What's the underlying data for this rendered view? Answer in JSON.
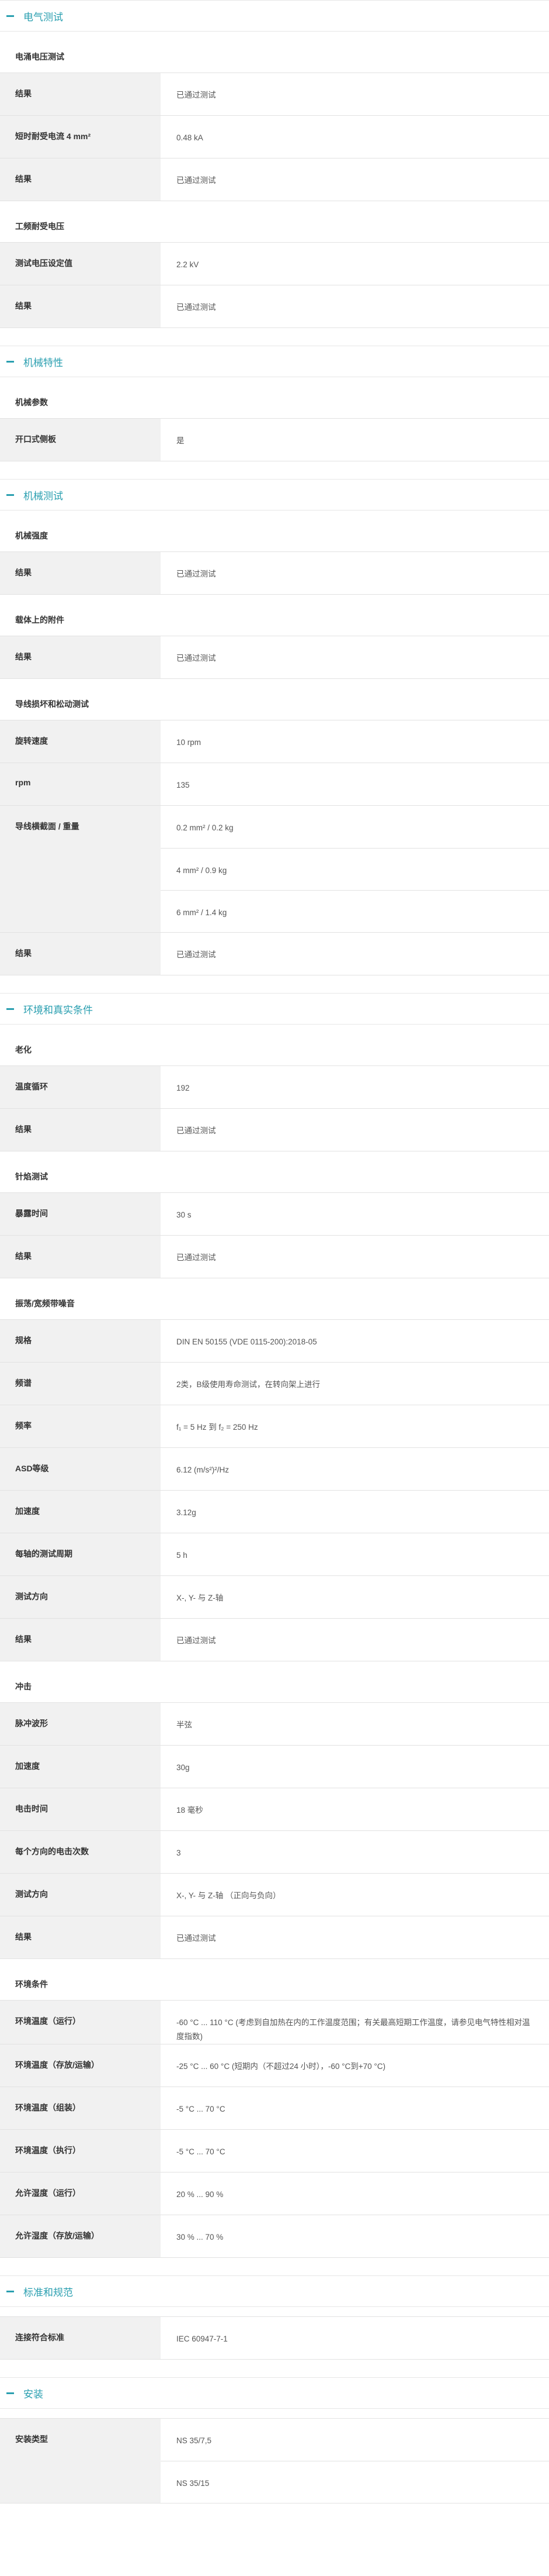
{
  "sections": [
    {
      "title": "电气测试",
      "groups": [
        {
          "title": "电涌电压测试",
          "rows": [
            {
              "label": "结果",
              "values": [
                "已通过测试"
              ]
            },
            {
              "label": "短时耐受电流 4 mm²",
              "values": [
                "0.48 kA"
              ]
            },
            {
              "label": "结果",
              "values": [
                "已通过测试"
              ]
            }
          ]
        },
        {
          "title": "工频耐受电压",
          "rows": [
            {
              "label": "测试电压设定值",
              "values": [
                "2.2 kV"
              ]
            },
            {
              "label": "结果",
              "values": [
                "已通过测试"
              ]
            }
          ]
        }
      ]
    },
    {
      "title": "机械特性",
      "groups": [
        {
          "title": "机械参数",
          "rows": [
            {
              "label": "开口式侧板",
              "values": [
                "是"
              ]
            }
          ]
        }
      ]
    },
    {
      "title": "机械测试",
      "groups": [
        {
          "title": "机械强度",
          "rows": [
            {
              "label": "结果",
              "values": [
                "已通过测试"
              ]
            }
          ]
        },
        {
          "title": "载体上的附件",
          "rows": [
            {
              "label": "结果",
              "values": [
                "已通过测试"
              ]
            }
          ]
        },
        {
          "title": "导线损坏和松动测试",
          "rows": [
            {
              "label": "旋转速度",
              "values": [
                "10 rpm"
              ]
            },
            {
              "label": "rpm",
              "values": [
                "135"
              ]
            },
            {
              "label": "导线横截面 / 重量",
              "values": [
                "0.2 mm² / 0.2 kg",
                "4 mm² / 0.9 kg",
                "6 mm² / 1.4 kg"
              ]
            },
            {
              "label": "结果",
              "values": [
                "已通过测试"
              ]
            }
          ]
        }
      ]
    },
    {
      "title": "环境和真实条件",
      "groups": [
        {
          "title": "老化",
          "rows": [
            {
              "label": "温度循环",
              "values": [
                "192"
              ]
            },
            {
              "label": "结果",
              "values": [
                "已通过测试"
              ]
            }
          ]
        },
        {
          "title": "针焰测试",
          "rows": [
            {
              "label": "暴露时间",
              "values": [
                "30 s"
              ]
            },
            {
              "label": "结果",
              "values": [
                "已通过测试"
              ]
            }
          ]
        },
        {
          "title": "振荡/宽频带噪音",
          "rows": [
            {
              "label": "规格",
              "values": [
                "DIN EN 50155 (VDE 0115-200):2018-05"
              ]
            },
            {
              "label": "频谱",
              "values": [
                "2类，B级使用寿命测试，在转向架上进行"
              ]
            },
            {
              "label": "频率",
              "values": [
                "f₁ = 5 Hz 到 f₂ = 250 Hz"
              ]
            },
            {
              "label": "ASD等级",
              "values": [
                "6.12 (m/s²)²/Hz"
              ]
            },
            {
              "label": "加速度",
              "values": [
                "3.12g"
              ]
            },
            {
              "label": "每轴的测试周期",
              "values": [
                "5 h"
              ]
            },
            {
              "label": "测试方向",
              "values": [
                "X-, Y- 与 Z-轴"
              ]
            },
            {
              "label": "结果",
              "values": [
                "已通过测试"
              ]
            }
          ]
        },
        {
          "title": "冲击",
          "rows": [
            {
              "label": "脉冲波形",
              "values": [
                "半弦"
              ]
            },
            {
              "label": "加速度",
              "values": [
                "30g"
              ]
            },
            {
              "label": "电击时间",
              "values": [
                "18 毫秒"
              ]
            },
            {
              "label": "每个方向的电击次数",
              "values": [
                "3"
              ]
            },
            {
              "label": "测试方向",
              "values": [
                "X-, Y- 与 Z-轴 （正向与负向）"
              ]
            },
            {
              "label": "结果",
              "values": [
                "已通过测试"
              ]
            }
          ]
        },
        {
          "title": "环境条件",
          "rows": [
            {
              "label": "环境温度（运行）",
              "values": [
                "-60 °C ... 110 °C (考虑到自加热在内的工作温度范围；有关最高短期工作温度，请参见电气特性相对温度指数)"
              ]
            },
            {
              "label": "环境温度（存放/运输）",
              "values": [
                "-25 °C ... 60 °C (短期内（不超过24 小时），-60 °C到+70 °C)"
              ]
            },
            {
              "label": "环境温度（组装）",
              "values": [
                "-5 °C ... 70 °C"
              ]
            },
            {
              "label": "环境温度（执行）",
              "values": [
                "-5 °C ... 70 °C"
              ]
            },
            {
              "label": "允许湿度（运行）",
              "values": [
                "20 % ... 90 %"
              ]
            },
            {
              "label": "允许湿度（存放/运输）",
              "values": [
                "30 % ... 70 %"
              ]
            }
          ]
        }
      ]
    },
    {
      "title": "标准和规范",
      "groups": [
        {
          "title": "",
          "rows": [
            {
              "label": "连接符合标准",
              "values": [
                "IEC 60947-7-1"
              ]
            }
          ]
        }
      ]
    },
    {
      "title": "安装",
      "groups": [
        {
          "title": "",
          "rows": [
            {
              "label": "安装类型",
              "values": [
                "NS 35/7,5",
                "NS 35/15"
              ]
            }
          ]
        }
      ]
    }
  ],
  "colors": {
    "accent": "#2a9fb0",
    "label_bg": "#f1f1f1",
    "border": "#e2e2e2"
  }
}
